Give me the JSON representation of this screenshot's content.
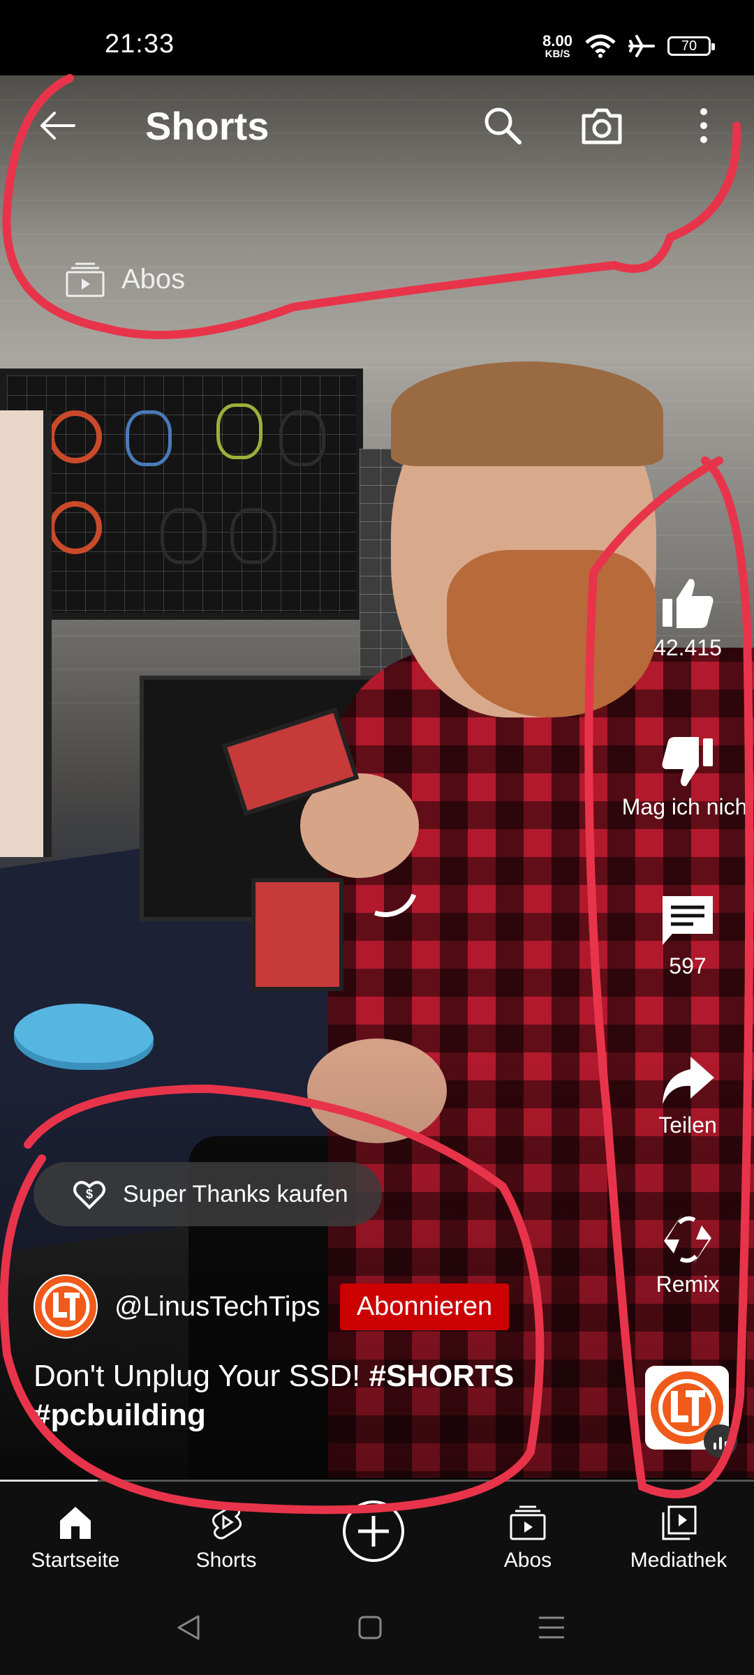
{
  "status_bar": {
    "time": "21:33",
    "speed_value": "8.00",
    "speed_unit": "KB/S",
    "battery": "70",
    "icons": [
      "wifi-icon",
      "airplane-icon",
      "battery-icon"
    ]
  },
  "header": {
    "title": "Shorts",
    "icons": [
      "back-arrow-icon",
      "search-icon",
      "camera-icon",
      "more-vert-icon"
    ],
    "subscriptions_chip": "Abos"
  },
  "actions": {
    "like_count": "42.415",
    "dislike_label": "Mag ich nicht",
    "comment_count": "597",
    "share_label": "Teilen",
    "remix_label": "Remix"
  },
  "video_info": {
    "super_thanks": "Super Thanks kaufen",
    "channel_handle": "@LinusTechTips",
    "subscribe_label": "Abonnieren",
    "caption_text": "Don't Unplug Your SSD! ",
    "caption_tag1": "#SHORTS",
    "caption_tag2": "#pcbuilding",
    "progress": 0.13
  },
  "bottom_nav": {
    "items": [
      {
        "label": "Startseite",
        "icon": "home-icon"
      },
      {
        "label": "Shorts",
        "icon": "shorts-icon"
      },
      {
        "label": "",
        "icon": "create-plus-icon"
      },
      {
        "label": "Abos",
        "icon": "subscriptions-icon"
      },
      {
        "label": "Mediathek",
        "icon": "library-icon"
      }
    ]
  },
  "colors": {
    "accent_red": "#cc0000",
    "annotation_red": "#e8344a",
    "nav_bg": "#0f0f0f"
  }
}
